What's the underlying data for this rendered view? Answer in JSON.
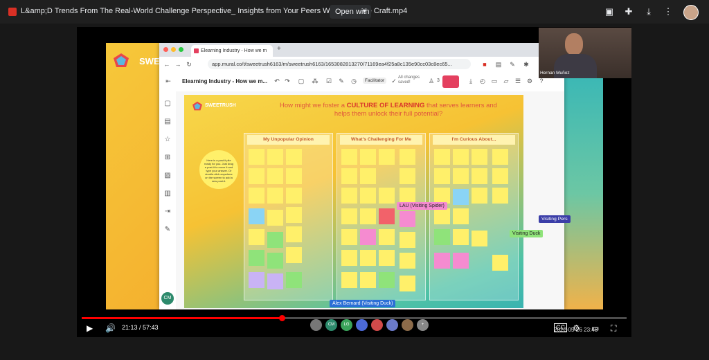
{
  "topbar": {
    "file_title": "L&amp;D Trends From The Real-World Challenge Perspective_ Insights from Your Peers Working In the Craft.mp4",
    "open_with": "Open with"
  },
  "slide": {
    "brand": "SWEETRUSH"
  },
  "browser": {
    "tab_title": "Elearning Industry - How we m",
    "url": "app.mural.co/t/sweetrush6163/m/sweetrush6163/1653082813270/71169ea4f25a8c135e90cc03c8ec65...",
    "board_name": "Elearning Industry - How we m...",
    "facilitator": "Facilitator",
    "saved": "All changes saved!",
    "user_count": "3"
  },
  "mural": {
    "brand": "SWEETRUSH",
    "title_pre": "How might we foster a ",
    "title_bold": "CULTURE OF LEARNING",
    "title_post": " that serves learners and helps them unlock their full potential?",
    "columns": [
      "My Unpopular Opinion",
      "What's Challenging For Me",
      "I'm Curious About..."
    ],
    "circle_note": "Here is a post it pile ready for you. Just drag a post-it to move it and type your answer. Or double-click anywhere on the screen to add a new post-it.",
    "tags": {
      "lau": "LAU (Visiting Spider)",
      "duck": "Visiting Duck",
      "alex": "Alex Bernard (Visiting Duck)"
    }
  },
  "webcam": {
    "name": "Hernan Muñoz"
  },
  "visiting_tag": "Visiting Pers",
  "left_avatar": "CM",
  "avatars": [
    "CM",
    "LG"
  ],
  "player": {
    "time": "21:13 / 57:43",
    "progress_fraction": 0.3676
  },
  "timestamp": "2022-05-26 23:48"
}
